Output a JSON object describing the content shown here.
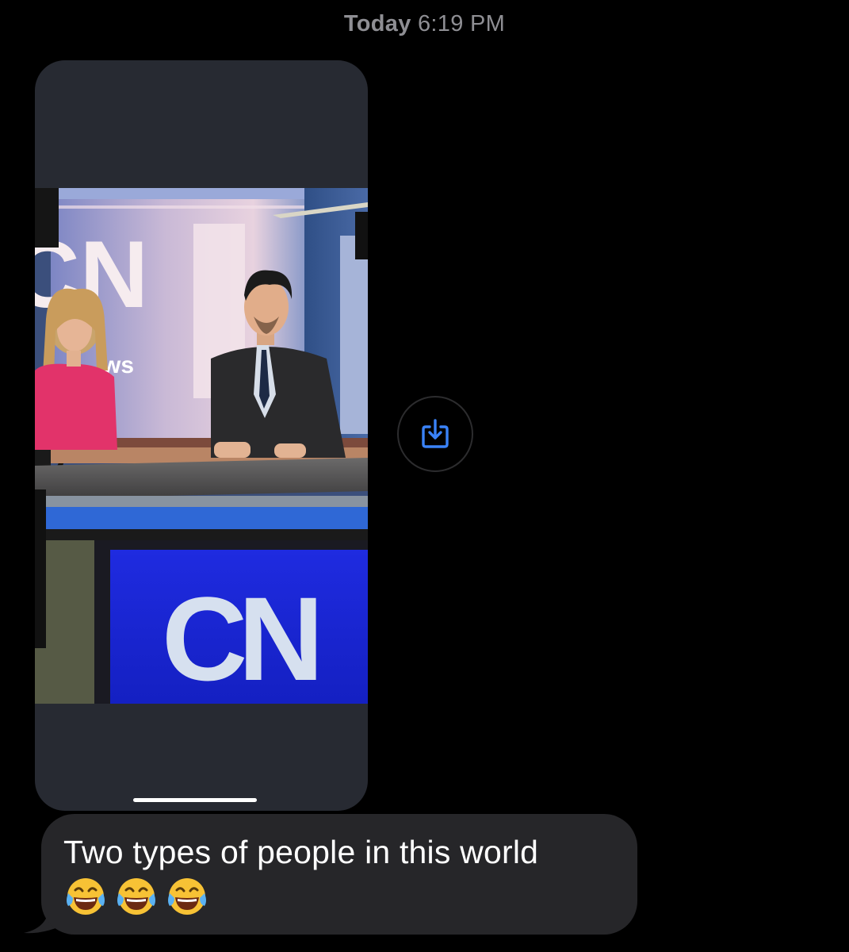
{
  "header": {
    "timestamp_day": "Today",
    "timestamp_time": "6:19 PM"
  },
  "attachment": {
    "photo_text": {
      "wall_logo": "CN",
      "wall_word": "ws",
      "desk_logo": "CN"
    }
  },
  "actions": {
    "save_icon": "square-arrow-down-icon"
  },
  "message": {
    "text": "Two types of people in this world",
    "emoji_names": [
      "face-with-tears-of-joy-icon",
      "face-with-tears-of-joy-icon",
      "face-with-tears-of-joy-icon"
    ]
  },
  "colors": {
    "background": "#000000",
    "bubble": "#262629",
    "attachment_frame": "#272a32",
    "accent": "#3a82f7",
    "timestamp": "#8e8e93"
  }
}
